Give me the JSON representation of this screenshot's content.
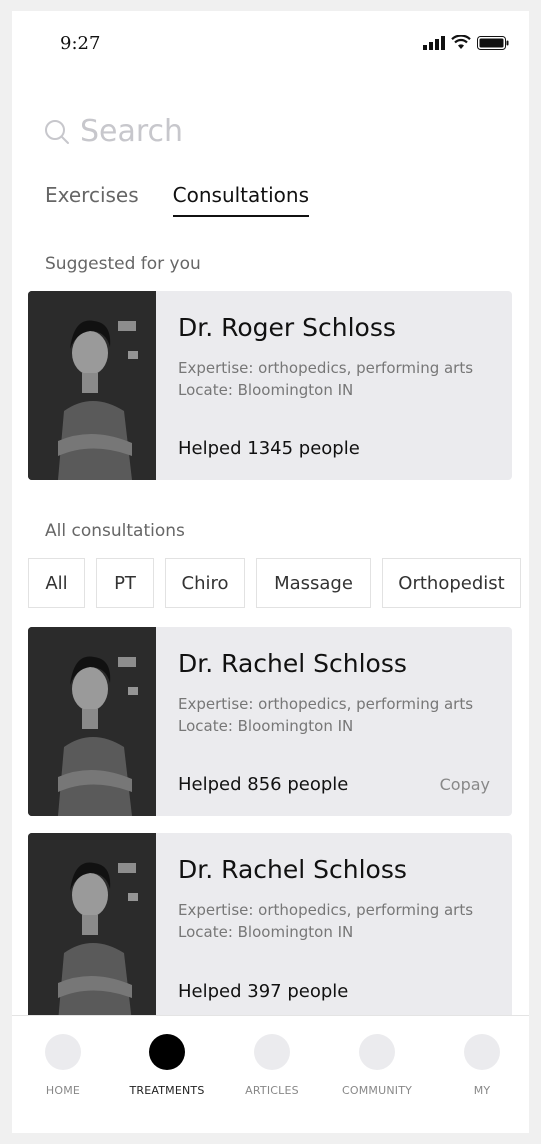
{
  "status": {
    "time": "9:27"
  },
  "search": {
    "placeholder": "Search"
  },
  "tabs": [
    {
      "label": "Exercises",
      "active": false
    },
    {
      "label": "Consultations",
      "active": true
    }
  ],
  "suggested": {
    "label": "Suggested for you",
    "card": {
      "name": "Dr. Roger Schloss",
      "expertise": "Expertise: orthopedics, performing arts",
      "locate": "Locate: Bloomington IN",
      "helped": "Helped 1345 people"
    }
  },
  "all": {
    "label": "All consultations",
    "filters": [
      "All",
      "PT",
      "Chiro",
      "Massage",
      "Orthopedist"
    ],
    "cards": [
      {
        "name": "Dr. Rachel Schloss",
        "expertise": "Expertise: orthopedics, performing arts",
        "locate": "Locate: Bloomington IN",
        "helped": "Helped 856 people",
        "copay": "Copay"
      },
      {
        "name": "Dr. Rachel Schloss",
        "expertise": "Expertise: orthopedics, performing arts",
        "locate": "Locate: Bloomington IN",
        "helped": "Helped 397 people"
      }
    ]
  },
  "nav": [
    {
      "label": "HOME",
      "active": false
    },
    {
      "label": "TREATMENTS",
      "active": true
    },
    {
      "label": "ARTICLES",
      "active": false
    },
    {
      "label": "COMMUNITY",
      "active": false
    },
    {
      "label": "MY",
      "active": false
    }
  ],
  "icons": {
    "signal": "signal-icon",
    "wifi": "wifi-icon",
    "battery": "battery-icon",
    "search": "search-icon"
  }
}
